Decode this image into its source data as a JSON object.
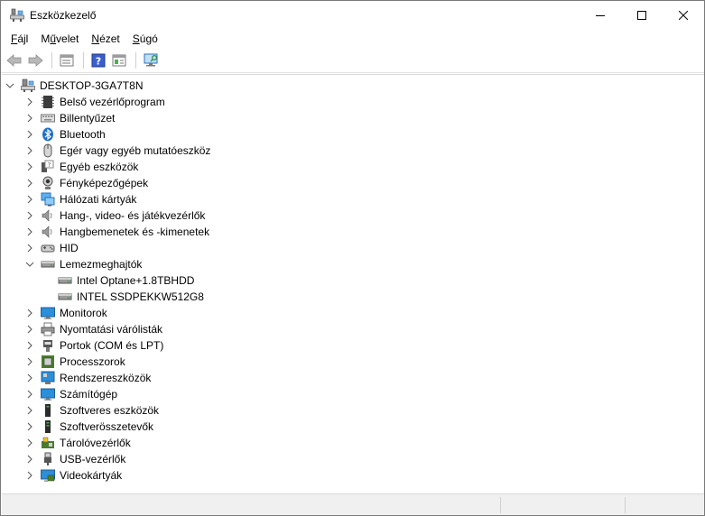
{
  "window": {
    "title": "Eszközkezelő",
    "controls": {
      "minimize": "minimize",
      "maximize": "maximize",
      "close": "close"
    }
  },
  "menu": [
    {
      "label_pre": "",
      "accel": "F",
      "label_post": "ájl"
    },
    {
      "label_pre": "M",
      "accel": "ű",
      "label_post": "velet"
    },
    {
      "label_pre": "",
      "accel": "N",
      "label_post": "ézet"
    },
    {
      "label_pre": "",
      "accel": "S",
      "label_post": "úgó"
    }
  ],
  "toolbar": {
    "buttons": [
      "back-arrow-icon",
      "forward-arrow-icon",
      "properties-icon",
      "help-icon",
      "update-driver-icon",
      "scan-hardware-icon"
    ]
  },
  "tree": {
    "root": {
      "label": "DESKTOP-3GA7T8N",
      "expanded": true,
      "icon": "computer-icon"
    },
    "categories": [
      {
        "label": "Belső vezérlőprogram",
        "icon": "firmware-icon",
        "expanded": false
      },
      {
        "label": "Billentyűzet",
        "icon": "keyboard-icon",
        "expanded": false
      },
      {
        "label": "Bluetooth",
        "icon": "bluetooth-icon",
        "expanded": false
      },
      {
        "label": "Egér vagy egyéb mutatóeszköz",
        "icon": "mouse-icon",
        "expanded": false
      },
      {
        "label": "Egyéb eszközök",
        "icon": "unknown-device-icon",
        "expanded": false
      },
      {
        "label": "Fényképezőgépek",
        "icon": "camera-icon",
        "expanded": false
      },
      {
        "label": "Hálózati kártyák",
        "icon": "network-adapter-icon",
        "expanded": false
      },
      {
        "label": "Hang-, video- és játékvezérlők",
        "icon": "speaker-icon",
        "expanded": false
      },
      {
        "label": "Hangbemenetek és -kimenetek",
        "icon": "audio-io-icon",
        "expanded": false
      },
      {
        "label": "HID",
        "icon": "hid-icon",
        "expanded": false
      },
      {
        "label": "Lemezmeghajtók",
        "icon": "disk-drive-icon",
        "expanded": true,
        "children": [
          {
            "label": "Intel Optane+1.8TBHDD",
            "icon": "disk-drive-icon"
          },
          {
            "label": "INTEL SSDPEKKW512G8",
            "icon": "disk-drive-icon"
          }
        ]
      },
      {
        "label": "Monitorok",
        "icon": "monitor-icon",
        "expanded": false
      },
      {
        "label": "Nyomtatási várólisták",
        "icon": "printer-icon",
        "expanded": false
      },
      {
        "label": "Portok (COM és LPT)",
        "icon": "port-icon",
        "expanded": false
      },
      {
        "label": "Processzorok",
        "icon": "processor-icon",
        "expanded": false
      },
      {
        "label": "Rendszereszközök",
        "icon": "system-devices-icon",
        "expanded": false
      },
      {
        "label": "Számítógép",
        "icon": "computer-monitor-icon",
        "expanded": false
      },
      {
        "label": "Szoftveres eszközök",
        "icon": "software-device-icon",
        "expanded": false
      },
      {
        "label": "Szoftverösszetevők",
        "icon": "software-component-icon",
        "expanded": false
      },
      {
        "label": "Tárolóvezérlők",
        "icon": "storage-controller-icon",
        "expanded": false
      },
      {
        "label": "USB-vezérlők",
        "icon": "usb-icon",
        "expanded": false
      },
      {
        "label": "Videokártyák",
        "icon": "display-adapter-icon",
        "expanded": false
      }
    ]
  },
  "colors": {
    "accent": "#0078d7",
    "selection": "#cce8ff",
    "monitor_blue": "#2b8fd9"
  }
}
